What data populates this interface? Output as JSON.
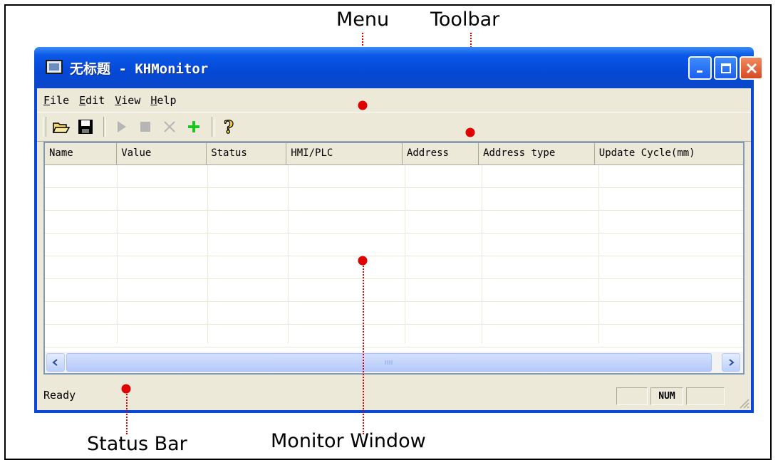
{
  "callouts": {
    "menu": "Menu",
    "toolbar": "Toolbar",
    "status_bar": "Status Bar",
    "monitor_window": "Monitor Window"
  },
  "window": {
    "title": "无标题 - KHMonitor"
  },
  "menu": {
    "items": [
      {
        "accel": "F",
        "rest": "ile"
      },
      {
        "accel": "E",
        "rest": "dit"
      },
      {
        "accel": "V",
        "rest": "iew"
      },
      {
        "accel": "H",
        "rest": "elp"
      }
    ]
  },
  "toolbar": {
    "icons": [
      "open-folder-icon",
      "save-icon",
      "run-icon",
      "stop-icon",
      "delete-icon",
      "add-icon",
      "help-icon"
    ]
  },
  "list": {
    "columns": [
      "Name",
      "Value",
      "Status",
      "HMI/PLC",
      "Address",
      "Address type",
      "Update Cycle(mm)"
    ],
    "rows": 8
  },
  "status": {
    "text": "Ready",
    "num": "NUM"
  },
  "colors": {
    "callout_marker": "#e00000",
    "titlebar": "#0a47d6",
    "client": "#ece9d8",
    "add_icon": "#1ec41e"
  }
}
